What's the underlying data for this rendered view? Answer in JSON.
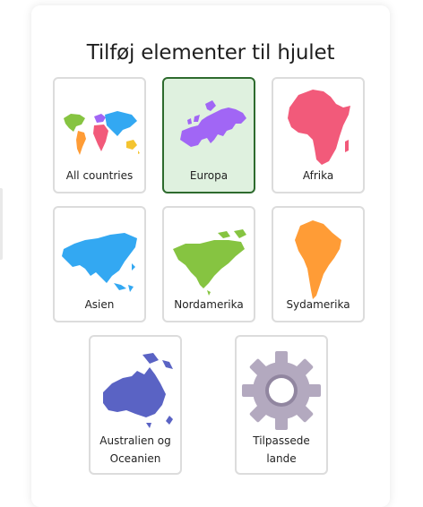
{
  "dialog": {
    "title": "Tilføj elementer til hjulet"
  },
  "options": [
    {
      "label": "All countries",
      "icon": "world-map-icon",
      "selected": false
    },
    {
      "label": "Europa",
      "icon": "europe-map-icon",
      "selected": true
    },
    {
      "label": "Afrika",
      "icon": "africa-map-icon",
      "selected": false
    },
    {
      "label": "Asien",
      "icon": "asia-map-icon",
      "selected": false
    },
    {
      "label": "Nordamerika",
      "icon": "north-america-map-icon",
      "selected": false
    },
    {
      "label": "Sydamerika",
      "icon": "south-america-map-icon",
      "selected": false
    },
    {
      "label": "Australien og Oceanien",
      "icon": "oceania-map-icon",
      "selected": false
    },
    {
      "label": "Tilpassede lande",
      "icon": "gear-icon",
      "selected": false
    }
  ],
  "colors": {
    "selected_bg": "#dff1df",
    "selected_border": "#2e6b2e",
    "card_border": "#dcdcdc",
    "europe": "#a166f5",
    "africa": "#f25a7a",
    "asia": "#33a8f2",
    "north_america": "#86c441",
    "south_america": "#ff9c36",
    "oceania": "#5a63c4",
    "gear": "#b3a9bf"
  }
}
